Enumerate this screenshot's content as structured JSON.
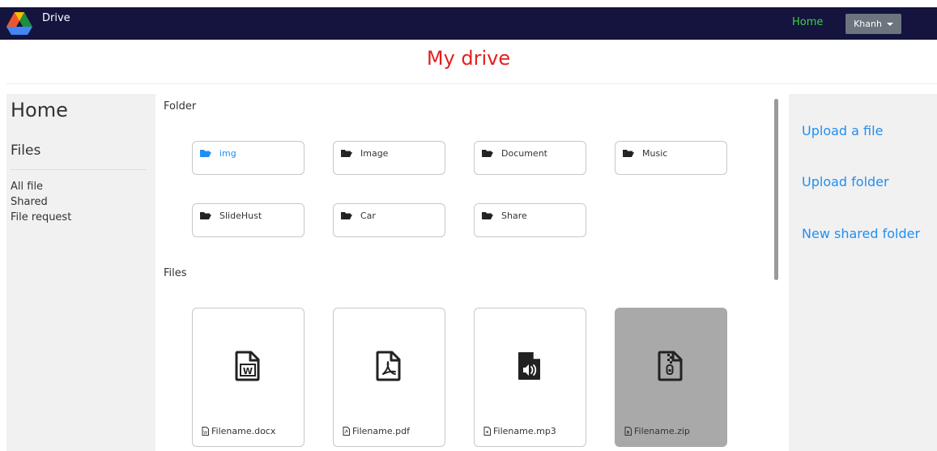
{
  "navbar": {
    "brand": "Drive",
    "home_link": "Home",
    "user_menu": "Khanh"
  },
  "page": {
    "title": "My drive"
  },
  "sidebar_left": {
    "home": "Home",
    "files": "Files",
    "links": [
      "All file",
      "Shared",
      "File request"
    ]
  },
  "main": {
    "folders_label": "Folder",
    "folders": [
      {
        "name": "img",
        "icon": "folder-open-icon",
        "active": true
      },
      {
        "name": "Image",
        "icon": "folder-open-icon",
        "active": false
      },
      {
        "name": "Document",
        "icon": "folder-open-icon",
        "active": false
      },
      {
        "name": "Music",
        "icon": "folder-open-icon",
        "active": false
      },
      {
        "name": "SlideHust",
        "icon": "folder-open-icon",
        "active": false
      },
      {
        "name": "Car",
        "icon": "folder-open-icon",
        "active": false
      },
      {
        "name": "Share",
        "icon": "folder-open-icon",
        "active": false
      }
    ],
    "files_label": "Files",
    "files": [
      {
        "name": "Filename.docx",
        "icon": "file-word-icon",
        "selected": false
      },
      {
        "name": "Filename.pdf",
        "icon": "file-pdf-icon",
        "selected": false
      },
      {
        "name": "Filename.mp3",
        "icon": "file-audio-icon",
        "selected": false
      },
      {
        "name": "Filename.zip",
        "icon": "file-archive-icon",
        "selected": true
      }
    ]
  },
  "sidebar_right": {
    "upload_file": "Upload a file",
    "upload_folder": "Upload folder",
    "new_shared_folder": "New shared folder"
  },
  "colors": {
    "navbar_bg": "#14143f",
    "home_link": "#3cd33c",
    "title": "#e41e1e",
    "accent_link": "#1f8ff0",
    "panel_bg": "#f1f1f1",
    "selected_card": "#a9a9a9"
  }
}
